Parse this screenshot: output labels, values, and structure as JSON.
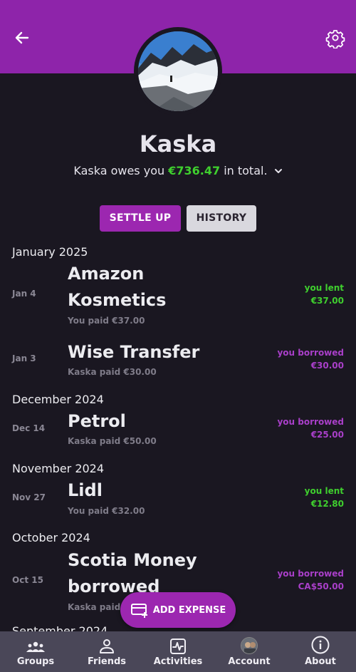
{
  "header": {
    "back_icon": "arrow-left-icon",
    "settings_icon": "gear-icon",
    "colors": {
      "bar": "#8e24aa",
      "background": "#1a1721"
    }
  },
  "profile": {
    "name": "Kaska",
    "summary_prefix": "Kaska owes you",
    "summary_amount": "€736.47",
    "summary_suffix": "in total.",
    "amount_color": "#3fcf2e"
  },
  "actions": {
    "settle_up": "SETTLE UP",
    "history": "HISTORY"
  },
  "months": {
    "jan2025": "January 2025",
    "dec2024": "December 2024",
    "nov2024": "November 2024",
    "oct2024": "October 2024",
    "sep2024": "September 2024"
  },
  "expenses": {
    "amazon": {
      "date": "Jan 4",
      "title_line1": "Amazon",
      "title_line2": "Kosmetics",
      "paid": "You paid €37.00",
      "status": "you lent",
      "amount": "€37.00"
    },
    "wise": {
      "date": "Jan 3",
      "title": "Wise Transfer",
      "paid": "Kaska paid €30.00",
      "status": "you borrowed",
      "amount": "€30.00"
    },
    "petrol": {
      "date": "Dec 14",
      "title": "Petrol",
      "paid": "Kaska paid €50.00",
      "status": "you borrowed",
      "amount": "€25.00"
    },
    "lidl": {
      "date": "Nov 27",
      "title": "Lidl",
      "paid": "You paid €32.00",
      "status": "you lent",
      "amount": "€12.80"
    },
    "scotia": {
      "date": "Oct 15",
      "title_line1": "Scotia Money",
      "title_line2": "borrowed",
      "paid": "Kaska paid",
      "status": "you borrowed",
      "amount": "CA$50.00"
    }
  },
  "fab": {
    "label": "ADD EXPENSE",
    "icon": "receipt-add-icon"
  },
  "nav": [
    {
      "label": "Groups",
      "icon": "groups-icon"
    },
    {
      "label": "Friends",
      "icon": "person-icon"
    },
    {
      "label": "Activities",
      "icon": "activity-icon"
    },
    {
      "label": "Account",
      "icon": "account-avatar"
    },
    {
      "label": "About",
      "icon": "info-icon"
    }
  ]
}
